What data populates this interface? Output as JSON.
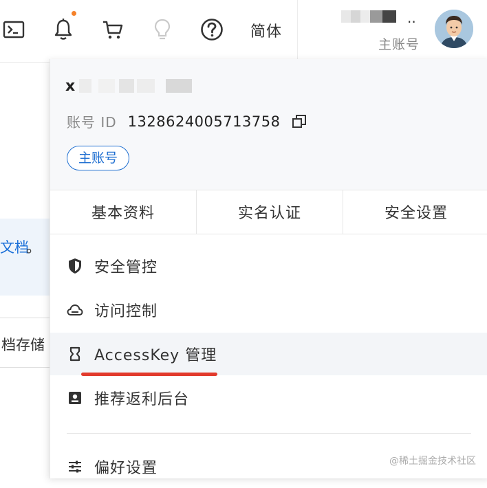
{
  "topbar": {
    "icons": [
      "terminal-icon",
      "bell-icon",
      "cart-icon",
      "bulb-icon",
      "help-icon"
    ],
    "notification_dot_color": "#f5812a",
    "language_label": "简体",
    "user": {
      "name_suffix": "..",
      "role_label": "主账号"
    }
  },
  "background": {
    "link_text": "文档",
    "period": "。",
    "storage_text": "档存储"
  },
  "panel": {
    "account_name_initial": "x",
    "account_id_label": "账号 ID",
    "account_id_value": "1328624005713758",
    "role_badge": "主账号",
    "tabs": [
      {
        "label": "基本资料"
      },
      {
        "label": "实名认证"
      },
      {
        "label": "安全设置"
      }
    ],
    "menu": [
      {
        "label": "安全管控",
        "icon": "shield-icon"
      },
      {
        "label": "访问控制",
        "icon": "cloud-icon"
      },
      {
        "label": "AccessKey 管理",
        "icon": "key-icon"
      },
      {
        "label": "推荐返利后台",
        "icon": "dashboard-icon"
      },
      {
        "label": "偏好设置",
        "icon": "sliders-icon"
      }
    ]
  },
  "colors": {
    "accent": "#1f6fd1",
    "highlight_underline": "#e23a2c"
  },
  "watermark": "@稀土掘金技术社区"
}
